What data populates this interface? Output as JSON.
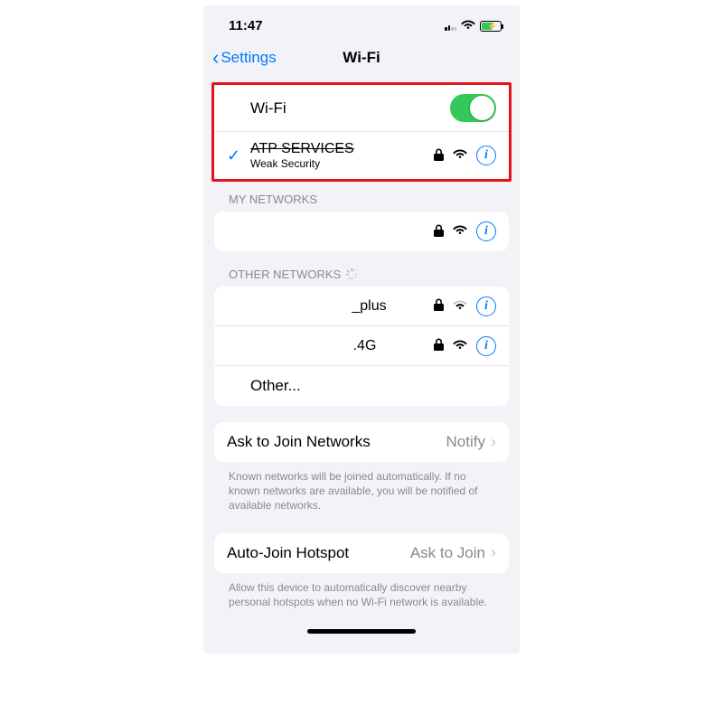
{
  "status": {
    "time": "11:47"
  },
  "nav": {
    "back_label": "Settings",
    "title": "Wi-Fi"
  },
  "wifi": {
    "toggle_label": "Wi-Fi",
    "toggle_on": true,
    "connected": {
      "ssid": "ATP SERVICES",
      "subtitle": "Weak Security",
      "locked": true
    }
  },
  "sections": {
    "my_networks_header": "MY NETWORKS",
    "my_networks": [
      {
        "ssid": "",
        "locked": true
      }
    ],
    "other_networks_header": "OTHER NETWORKS",
    "other_networks": [
      {
        "ssid": "_plus",
        "locked": true,
        "signal": "weak"
      },
      {
        "ssid": ".4G",
        "locked": true,
        "signal": "full"
      }
    ],
    "other_label": "Other..."
  },
  "settings": {
    "ask_to_join": {
      "label": "Ask to Join Networks",
      "value": "Notify",
      "footer": "Known networks will be joined automatically. If no known networks are available, you will be notified of available networks."
    },
    "auto_join": {
      "label": "Auto-Join Hotspot",
      "value": "Ask to Join",
      "footer": "Allow this device to automatically discover nearby personal hotspots when no Wi-Fi network is available."
    }
  }
}
